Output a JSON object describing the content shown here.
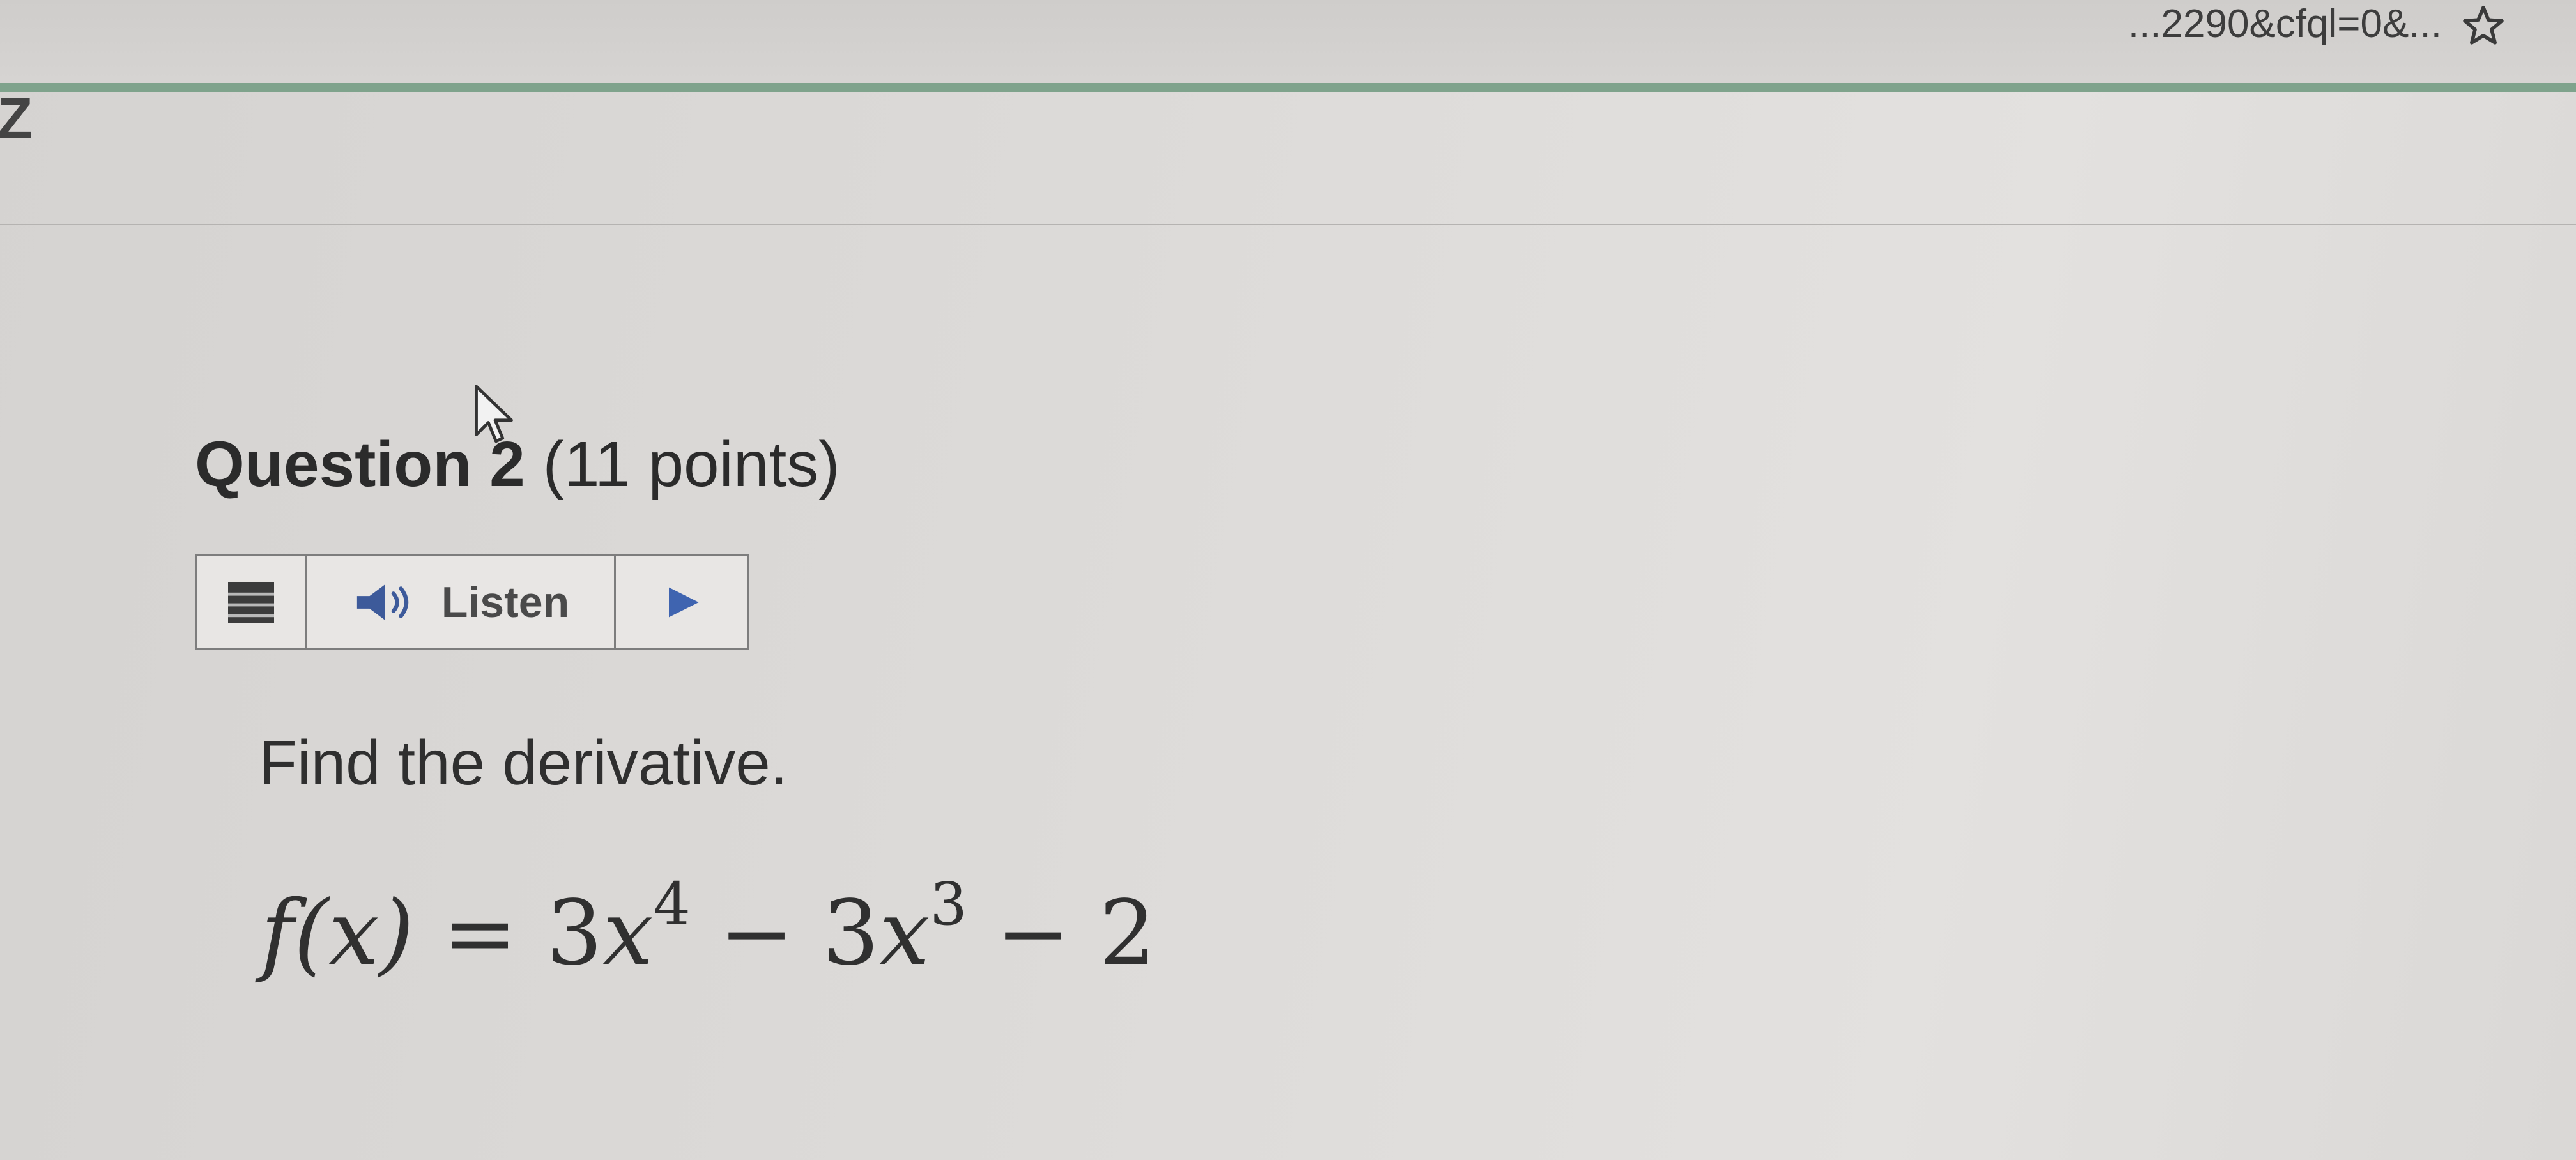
{
  "browser": {
    "url_tail": "...2290&cfql=0&...",
    "bookmark_icon": "star-icon"
  },
  "side_mark": "Z",
  "question": {
    "label": "Question 2",
    "points": "(11 points)"
  },
  "listen_toolbar": {
    "menu_icon": "menu-icon",
    "speaker_icon": "speaker-icon",
    "listen_label": "Listen",
    "play_icon": "play-icon"
  },
  "problem": {
    "instruction": "Find the derivative.",
    "formula_lhs": "f(x)",
    "equals": "=",
    "coef1": "3",
    "var1": "x",
    "exp1": "4",
    "op1": "−",
    "coef2": "3",
    "var2": "x",
    "exp2": "3",
    "op2": "−",
    "const": "2"
  },
  "colors": {
    "accent_strip": "#7fa38c",
    "text": "#2b2b2b",
    "speaker_blue": "#3d5a9a",
    "play_blue": "#3f64b0"
  }
}
